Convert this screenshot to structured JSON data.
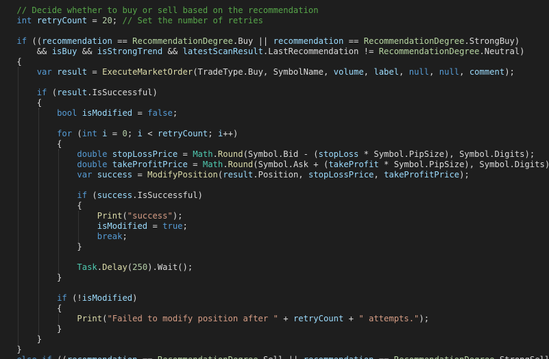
{
  "colors": {
    "background": "#1e1e1e",
    "plain": "#dcdcdc",
    "keyword": "#569cd6",
    "comment": "#57a64a",
    "enum_type": "#b8d7a3",
    "method": "#dcdcaa",
    "class": "#4ec9b0",
    "variable": "#9cdcfe",
    "number": "#b5cea8",
    "string": "#d69d85"
  },
  "code_lines": [
    [
      [
        "    ",
        "p"
      ],
      [
        "// Decide whether to buy or sell based on the recommendation",
        "c"
      ]
    ],
    [
      [
        "    ",
        "p"
      ],
      [
        "int",
        "k"
      ],
      [
        " ",
        "p"
      ],
      [
        "retryCount",
        "v"
      ],
      [
        " = ",
        "p"
      ],
      [
        "20",
        "n"
      ],
      [
        "; ",
        "p"
      ],
      [
        "// Set the number of retries",
        "c"
      ]
    ],
    [
      [
        "",
        "p"
      ]
    ],
    [
      [
        "    ",
        "p"
      ],
      [
        "if",
        "k"
      ],
      [
        " ((",
        "p"
      ],
      [
        "recommendation",
        "v"
      ],
      [
        " == ",
        "p"
      ],
      [
        "RecommendationDegree",
        "e"
      ],
      [
        ".Buy || ",
        "p"
      ],
      [
        "recommendation",
        "v"
      ],
      [
        " == ",
        "p"
      ],
      [
        "RecommendationDegree",
        "e"
      ],
      [
        ".StrongBuy)",
        "p"
      ]
    ],
    [
      [
        "        && ",
        "p"
      ],
      [
        "isBuy",
        "v"
      ],
      [
        " && ",
        "p"
      ],
      [
        "isStrongTrend",
        "v"
      ],
      [
        " && ",
        "p"
      ],
      [
        "latestScanResult",
        "v"
      ],
      [
        ".LastRecommendation != ",
        "p"
      ],
      [
        "RecommendationDegree",
        "e"
      ],
      [
        ".Neutral)",
        "p"
      ]
    ],
    [
      [
        "    {",
        "p"
      ]
    ],
    [
      [
        "        ",
        "p"
      ],
      [
        "var",
        "k"
      ],
      [
        " ",
        "p"
      ],
      [
        "result",
        "v"
      ],
      [
        " = ",
        "p"
      ],
      [
        "ExecuteMarketOrder",
        "m"
      ],
      [
        "(TradeType.Buy, SymbolName, ",
        "p"
      ],
      [
        "volume",
        "v"
      ],
      [
        ", ",
        "p"
      ],
      [
        "label",
        "v"
      ],
      [
        ", ",
        "p"
      ],
      [
        "null",
        "k"
      ],
      [
        ", ",
        "p"
      ],
      [
        "null",
        "k"
      ],
      [
        ", ",
        "p"
      ],
      [
        "comment",
        "v"
      ],
      [
        ");",
        "p"
      ]
    ],
    [
      [
        "",
        "p"
      ]
    ],
    [
      [
        "        ",
        "p"
      ],
      [
        "if",
        "k"
      ],
      [
        " (",
        "p"
      ],
      [
        "result",
        "v"
      ],
      [
        ".IsSuccessful)",
        "p"
      ]
    ],
    [
      [
        "        {",
        "p"
      ]
    ],
    [
      [
        "            ",
        "p"
      ],
      [
        "bool",
        "k"
      ],
      [
        " ",
        "p"
      ],
      [
        "isModified",
        "v"
      ],
      [
        " = ",
        "p"
      ],
      [
        "false",
        "k"
      ],
      [
        ";",
        "p"
      ]
    ],
    [
      [
        "",
        "p"
      ]
    ],
    [
      [
        "            ",
        "p"
      ],
      [
        "for",
        "k"
      ],
      [
        " (",
        "p"
      ],
      [
        "int",
        "k"
      ],
      [
        " ",
        "p"
      ],
      [
        "i",
        "v"
      ],
      [
        " = ",
        "p"
      ],
      [
        "0",
        "n"
      ],
      [
        "; ",
        "p"
      ],
      [
        "i",
        "v"
      ],
      [
        " < ",
        "p"
      ],
      [
        "retryCount",
        "v"
      ],
      [
        "; ",
        "p"
      ],
      [
        "i",
        "v"
      ],
      [
        "++)",
        "p"
      ]
    ],
    [
      [
        "            {",
        "p"
      ]
    ],
    [
      [
        "                ",
        "p"
      ],
      [
        "double",
        "k"
      ],
      [
        " ",
        "p"
      ],
      [
        "stopLossPrice",
        "v"
      ],
      [
        " = ",
        "p"
      ],
      [
        "Math",
        "t"
      ],
      [
        ".",
        "p"
      ],
      [
        "Round",
        "m"
      ],
      [
        "(Symbol.Bid - (",
        "p"
      ],
      [
        "stopLoss",
        "v"
      ],
      [
        " * Symbol.PipSize), Symbol.Digits);",
        "p"
      ]
    ],
    [
      [
        "                ",
        "p"
      ],
      [
        "double",
        "k"
      ],
      [
        " ",
        "p"
      ],
      [
        "takeProfitPrice",
        "v"
      ],
      [
        " = ",
        "p"
      ],
      [
        "Math",
        "t"
      ],
      [
        ".",
        "p"
      ],
      [
        "Round",
        "m"
      ],
      [
        "(Symbol.Ask + (",
        "p"
      ],
      [
        "takeProfit",
        "v"
      ],
      [
        " * Symbol.PipSize), Symbol.Digits);",
        "p"
      ]
    ],
    [
      [
        "                ",
        "p"
      ],
      [
        "var",
        "k"
      ],
      [
        " ",
        "p"
      ],
      [
        "success",
        "v"
      ],
      [
        " = ",
        "p"
      ],
      [
        "ModifyPosition",
        "m"
      ],
      [
        "(",
        "p"
      ],
      [
        "result",
        "v"
      ],
      [
        ".Position, ",
        "p"
      ],
      [
        "stopLossPrice",
        "v"
      ],
      [
        ", ",
        "p"
      ],
      [
        "takeProfitPrice",
        "v"
      ],
      [
        ");",
        "p"
      ]
    ],
    [
      [
        "",
        "p"
      ]
    ],
    [
      [
        "                ",
        "p"
      ],
      [
        "if",
        "k"
      ],
      [
        " (",
        "p"
      ],
      [
        "success",
        "v"
      ],
      [
        ".IsSuccessful)",
        "p"
      ]
    ],
    [
      [
        "                {",
        "p"
      ]
    ],
    [
      [
        "                    ",
        "p"
      ],
      [
        "Print",
        "m"
      ],
      [
        "(",
        "p"
      ],
      [
        "\"success\"",
        "s"
      ],
      [
        ");",
        "p"
      ]
    ],
    [
      [
        "                    ",
        "p"
      ],
      [
        "isModified",
        "v"
      ],
      [
        " = ",
        "p"
      ],
      [
        "true",
        "k"
      ],
      [
        ";",
        "p"
      ]
    ],
    [
      [
        "                    ",
        "p"
      ],
      [
        "break",
        "k"
      ],
      [
        ";",
        "p"
      ]
    ],
    [
      [
        "                }",
        "p"
      ]
    ],
    [
      [
        "",
        "p"
      ]
    ],
    [
      [
        "                ",
        "p"
      ],
      [
        "Task",
        "t"
      ],
      [
        ".",
        "p"
      ],
      [
        "Delay",
        "m"
      ],
      [
        "(",
        "p"
      ],
      [
        "250",
        "n"
      ],
      [
        ").Wait();",
        "p"
      ]
    ],
    [
      [
        "            }",
        "p"
      ]
    ],
    [
      [
        "",
        "p"
      ]
    ],
    [
      [
        "            ",
        "p"
      ],
      [
        "if",
        "k"
      ],
      [
        " (!",
        "p"
      ],
      [
        "isModified",
        "v"
      ],
      [
        ")",
        "p"
      ]
    ],
    [
      [
        "            {",
        "p"
      ]
    ],
    [
      [
        "                ",
        "p"
      ],
      [
        "Print",
        "m"
      ],
      [
        "(",
        "p"
      ],
      [
        "\"Failed to modify position after \"",
        "s"
      ],
      [
        " + ",
        "p"
      ],
      [
        "retryCount",
        "v"
      ],
      [
        " + ",
        "p"
      ],
      [
        "\" attempts.\"",
        "s"
      ],
      [
        ");",
        "p"
      ]
    ],
    [
      [
        "            }",
        "p"
      ]
    ],
    [
      [
        "        }",
        "p"
      ]
    ],
    [
      [
        "    }",
        "p"
      ]
    ],
    [
      [
        "    ",
        "p"
      ],
      [
        "else",
        "k"
      ],
      [
        " ",
        "p"
      ],
      [
        "if",
        "k"
      ],
      [
        " ((",
        "p"
      ],
      [
        "recommendation",
        "v"
      ],
      [
        " == ",
        "p"
      ],
      [
        "RecommendationDegree",
        "e"
      ],
      [
        ".Sell || ",
        "p"
      ],
      [
        "recommendation",
        "v"
      ],
      [
        " == ",
        "p"
      ],
      [
        "RecommendationDegree",
        "e"
      ],
      [
        ".StrongSell)",
        "p"
      ]
    ]
  ]
}
